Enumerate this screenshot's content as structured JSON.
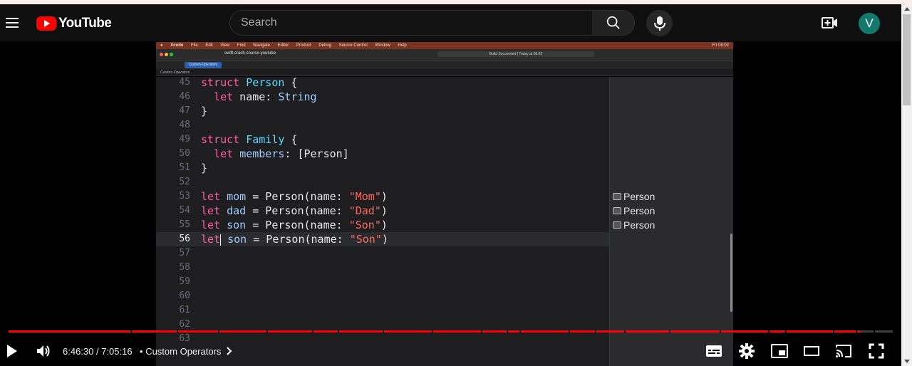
{
  "header": {
    "logo_text": "YouTube",
    "search_placeholder": "Search",
    "avatar_letter": "V"
  },
  "video": {
    "mac_menubar": {
      "app": "Xcode",
      "menus": [
        "File",
        "Edit",
        "View",
        "Find",
        "Navigate",
        "Editor",
        "Product",
        "Debug",
        "Source Control",
        "Window",
        "Help"
      ],
      "clock": "Fri 08:02"
    },
    "xcode": {
      "project": "swift-crash-course-youtube",
      "status": "Build Succeeded | Today at 08:02",
      "tab": "Custom-Operators",
      "jump_bar": "Custom-Operators"
    },
    "code_lines": [
      {
        "n": "45",
        "tokens": [
          [
            "kw",
            "struct"
          ],
          [
            "plain",
            " "
          ],
          [
            "tyd",
            "Person"
          ],
          [
            "plain",
            " {"
          ]
        ]
      },
      {
        "n": "46",
        "tokens": [
          [
            "plain",
            "  "
          ],
          [
            "kw",
            "let"
          ],
          [
            "plain",
            " name: "
          ],
          [
            "ty",
            "String"
          ]
        ]
      },
      {
        "n": "47",
        "tokens": [
          [
            "plain",
            "}"
          ]
        ]
      },
      {
        "n": "48",
        "tokens": []
      },
      {
        "n": "49",
        "tokens": [
          [
            "kw",
            "struct"
          ],
          [
            "plain",
            " "
          ],
          [
            "tyd",
            "Family"
          ],
          [
            "plain",
            " {"
          ]
        ]
      },
      {
        "n": "50",
        "tokens": [
          [
            "plain",
            "  "
          ],
          [
            "kw",
            "let"
          ],
          [
            "plain",
            " "
          ],
          [
            "ty",
            "members"
          ],
          [
            "plain",
            ": ["
          ],
          [
            "plain",
            "Person"
          ],
          [
            "plain",
            "]"
          ]
        ]
      },
      {
        "n": "51",
        "tokens": [
          [
            "plain",
            "}"
          ]
        ]
      },
      {
        "n": "52",
        "tokens": []
      },
      {
        "n": "53",
        "tokens": [
          [
            "kw",
            "let"
          ],
          [
            "plain",
            " "
          ],
          [
            "ty",
            "mom"
          ],
          [
            "plain",
            " = Person(name: "
          ],
          [
            "str",
            "\"Mom\""
          ],
          [
            "plain",
            ")"
          ]
        ]
      },
      {
        "n": "54",
        "tokens": [
          [
            "kw",
            "let"
          ],
          [
            "plain",
            " "
          ],
          [
            "ty",
            "dad"
          ],
          [
            "plain",
            " = Person(name: "
          ],
          [
            "str",
            "\"Dad\""
          ],
          [
            "plain",
            ")"
          ]
        ]
      },
      {
        "n": "55",
        "tokens": [
          [
            "kw",
            "let"
          ],
          [
            "plain",
            " "
          ],
          [
            "ty",
            "son"
          ],
          [
            "plain",
            " = Person(name: "
          ],
          [
            "str",
            "\"Son\""
          ],
          [
            "plain",
            ")"
          ]
        ]
      },
      {
        "n": "56",
        "tokens": [
          [
            "kw",
            "let"
          ],
          [
            "cursor",
            ""
          ],
          [
            "plain",
            " "
          ],
          [
            "ty",
            "son"
          ],
          [
            "plain",
            " = Person(name: "
          ],
          [
            "str",
            "\"Son\""
          ],
          [
            "plain",
            ")"
          ]
        ],
        "current": true
      },
      {
        "n": "57",
        "tokens": []
      },
      {
        "n": "58",
        "tokens": []
      },
      {
        "n": "59",
        "tokens": []
      },
      {
        "n": "60",
        "tokens": []
      },
      {
        "n": "61",
        "tokens": []
      },
      {
        "n": "62",
        "tokens": []
      },
      {
        "n": "63",
        "tokens": []
      }
    ],
    "results": [
      {
        "line": "53",
        "label": "Person"
      },
      {
        "line": "54",
        "label": "Person"
      },
      {
        "line": "55",
        "label": "Person"
      }
    ]
  },
  "player": {
    "progress_fraction": 0.9635,
    "current_time": "6:46:30",
    "duration": "7:05:16",
    "separator": "•",
    "chapter": "Custom Operators",
    "chapter_marks": [
      0.138,
      0.19,
      0.237,
      0.292,
      0.343,
      0.372,
      0.423,
      0.479,
      0.534,
      0.563,
      0.578,
      0.633,
      0.663,
      0.696,
      0.747,
      0.804,
      0.859,
      0.878,
      0.932,
      0.958,
      0.978
    ]
  },
  "colors": {
    "youtube_red": "#ff0000",
    "avatar_bg": "#12796c",
    "keyword": "#fc5fa3",
    "string": "#fc6a5d",
    "type": "#9ecbff"
  }
}
